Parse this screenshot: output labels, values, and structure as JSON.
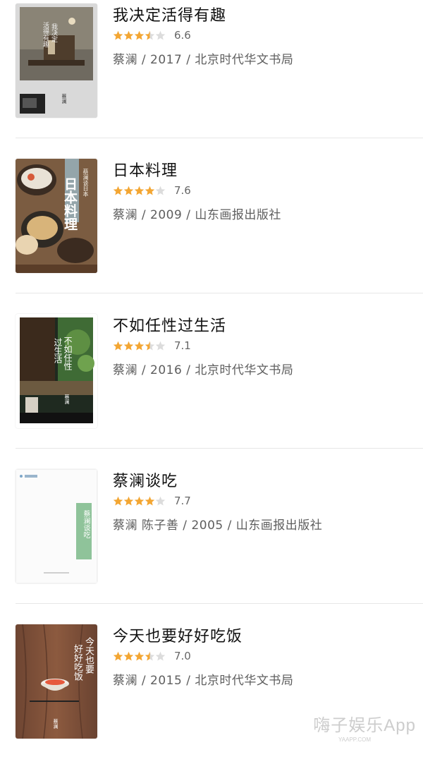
{
  "colors": {
    "star_filled": "#f3a633",
    "star_empty": "#dcdcdc"
  },
  "books": [
    {
      "title": "我决定活得有趣",
      "stars": 3.5,
      "score": "6.6",
      "meta": "蔡澜 / 2017 / 北京时代华文书局",
      "cover_text": [
        "我决定",
        "活得有趣",
        "蔡澜"
      ]
    },
    {
      "title": "日本料理",
      "stars": 4,
      "score": "7.6",
      "meta": "蔡澜 / 2009 / 山东画报出版社",
      "cover_text": [
        "日本料理",
        "蔡澜谈日本"
      ]
    },
    {
      "title": "不如任性过生活",
      "stars": 3.5,
      "score": "7.1",
      "meta": "蔡澜 / 2016 / 北京时代华文书局",
      "cover_text": [
        "不如任性",
        "过生活",
        "蔡澜"
      ]
    },
    {
      "title": "蔡澜谈吃",
      "stars": 4,
      "score": "7.7",
      "meta": "蔡澜 陈子善 / 2005 / 山东画报出版社",
      "cover_text": [
        "蔡澜谈吃"
      ]
    },
    {
      "title": "今天也要好好吃饭",
      "stars": 3.5,
      "score": "7.0",
      "meta": "蔡澜 / 2015 / 北京时代华文书局",
      "cover_text": [
        "今天也要",
        "好好吃饭",
        "蔡澜"
      ]
    }
  ],
  "watermark": {
    "text": "嗨子娱乐App",
    "sub": "YAAPP.COM"
  }
}
